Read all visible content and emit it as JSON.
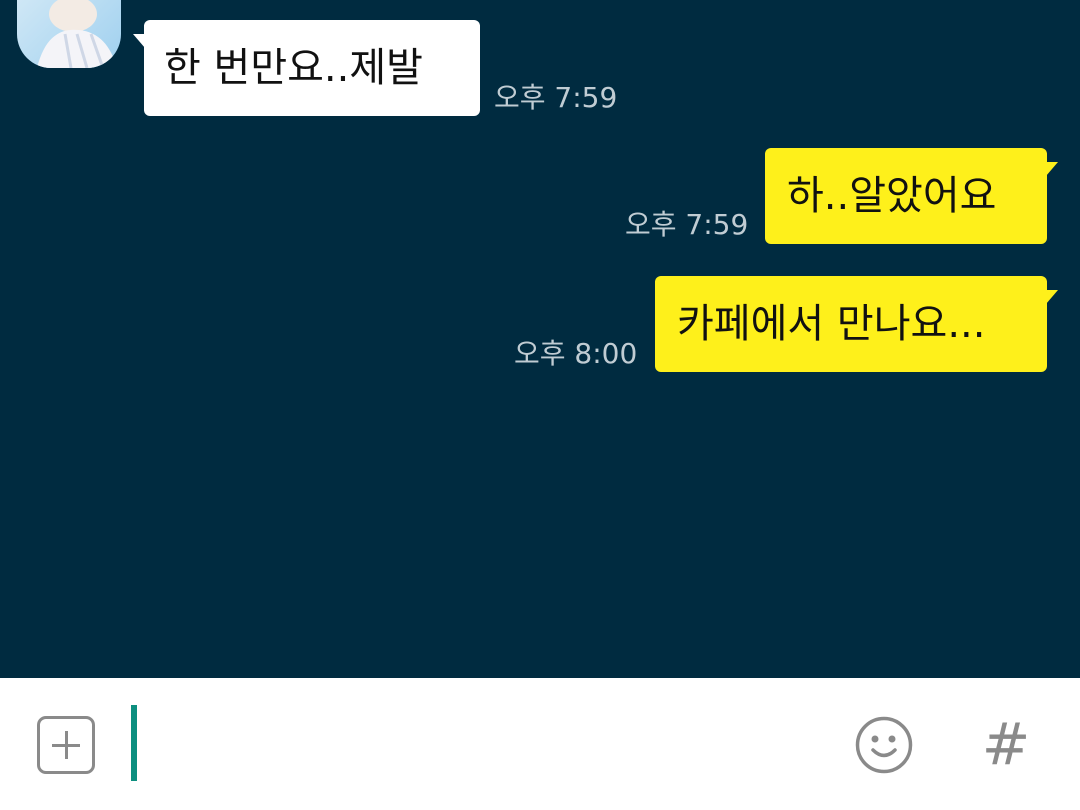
{
  "chat": {
    "background": "#002b40",
    "sender": {
      "name": ""
    },
    "messages": [
      {
        "direction": "incoming",
        "text": "한 번만요..제발",
        "time": "오후 7:59"
      },
      {
        "direction": "outgoing",
        "text": "하..알았어요",
        "time": "오후 7:59"
      },
      {
        "direction": "outgoing",
        "text": "카페에서 만나요...",
        "time": "오후 8:00"
      }
    ]
  },
  "colors": {
    "incoming_bubble": "#ffffff",
    "outgoing_bubble": "#fef01b",
    "timestamp": "#c0ccd3",
    "caret": "#0d8f7f",
    "icon": "#8a8a8a"
  },
  "composer": {
    "input_value": "",
    "icons": [
      "plus-icon",
      "emoji-icon",
      "hash-icon"
    ],
    "hash_glyph": "#"
  }
}
